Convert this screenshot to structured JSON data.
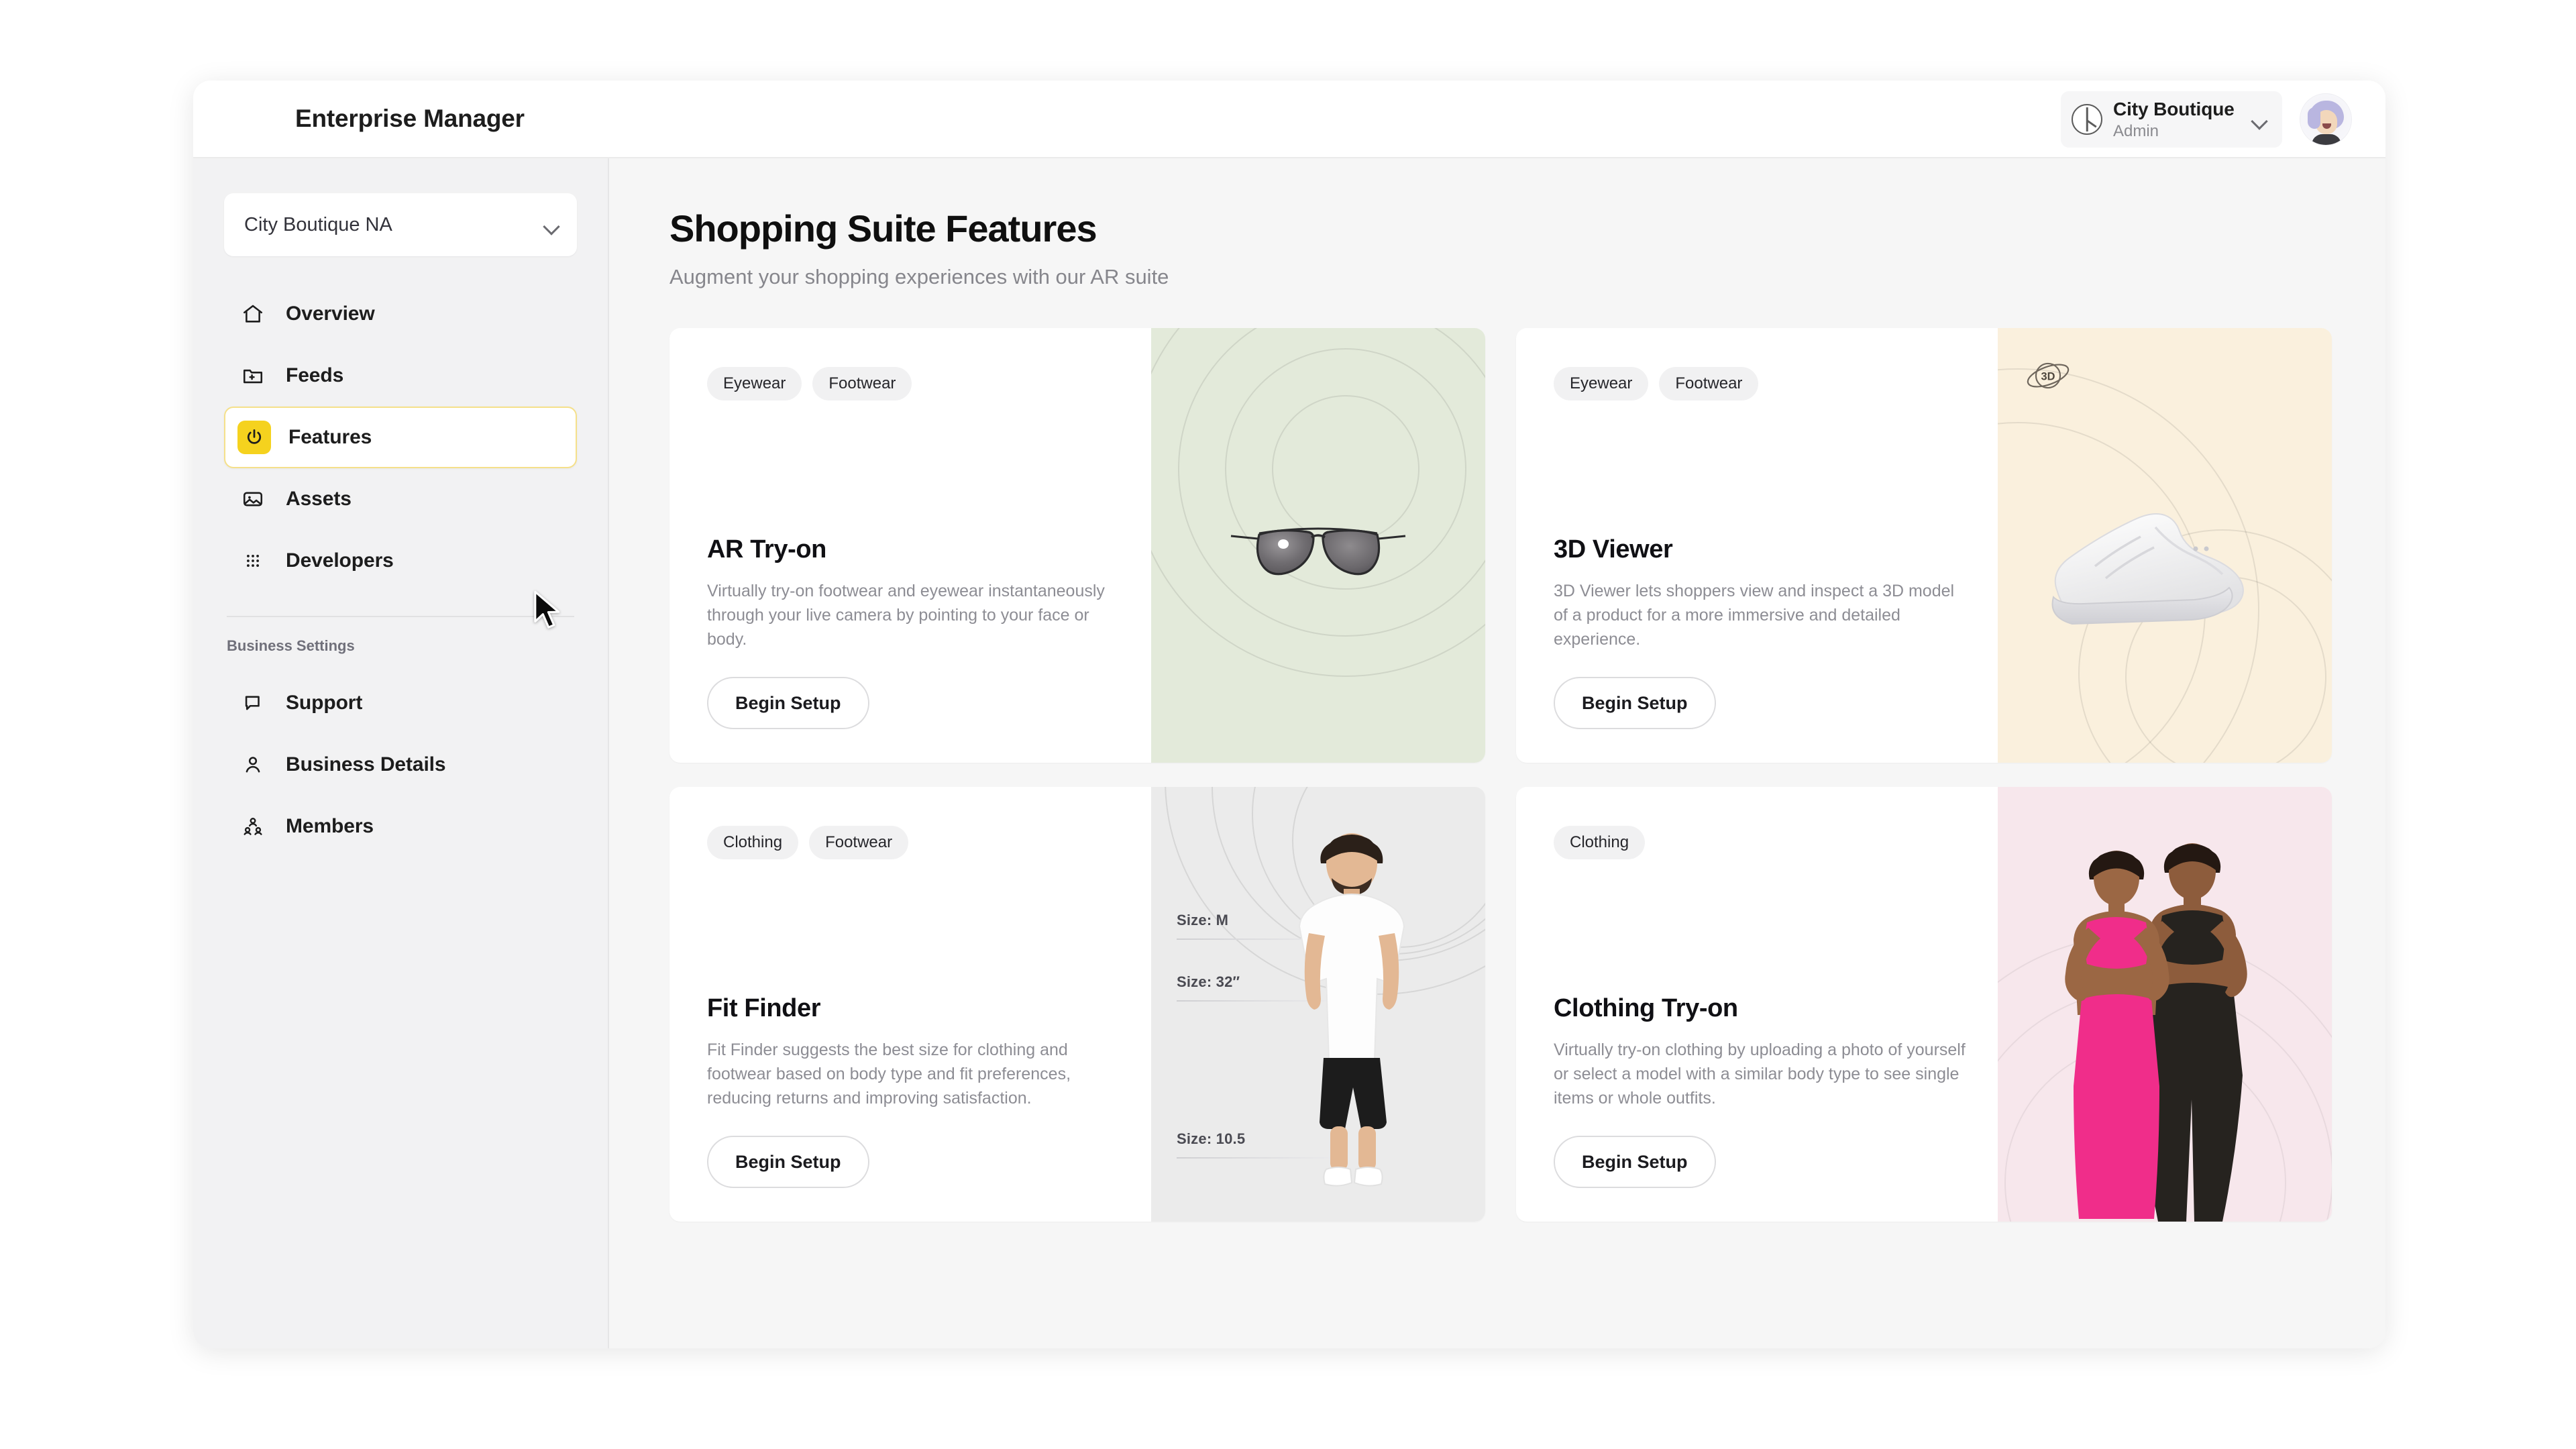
{
  "header": {
    "app_title": "Enterprise Manager",
    "org_name": "City Boutique",
    "org_role": "Admin",
    "org_logo_icon": "circle-chart-icon",
    "chevron_icon": "chevron-down-icon",
    "avatar_icon": "user-avatar"
  },
  "sidebar": {
    "store_select": {
      "value": "City Boutique NA",
      "chevron_icon": "chevron-down-icon"
    },
    "items": [
      {
        "label": "Overview",
        "icon": "home-icon",
        "active": false
      },
      {
        "label": "Feeds",
        "icon": "folder-add-icon",
        "active": false
      },
      {
        "label": "Features",
        "icon": "power-icon",
        "active": true
      },
      {
        "label": "Assets",
        "icon": "image-icon",
        "active": false
      },
      {
        "label": "Developers",
        "icon": "grid-dots-icon",
        "active": false
      }
    ],
    "section_title": "Business Settings",
    "settings_items": [
      {
        "label": "Support",
        "icon": "chat-bubble-icon"
      },
      {
        "label": "Business Details",
        "icon": "person-icon"
      },
      {
        "label": "Members",
        "icon": "people-group-icon"
      }
    ]
  },
  "main": {
    "title": "Shopping Suite Features",
    "subtitle": "Augment your shopping experiences with our AR suite",
    "cards": [
      {
        "chips": [
          "Eyewear",
          "Footwear"
        ],
        "title": "AR Try-on",
        "description": "Virtually try-on footwear and eyewear instantaneously through your live camera by pointing to your face or body.",
        "button": "Begin Setup",
        "media": {
          "variant": "media-green",
          "bg": "#e3eada",
          "art": "sunglasses"
        }
      },
      {
        "chips": [
          "Eyewear",
          "Footwear"
        ],
        "title": "3D Viewer",
        "description": "3D Viewer lets shoppers view and inspect a 3D model of a product for a more immersive and detailed experience.",
        "button": "Begin Setup",
        "media": {
          "variant": "media-cream",
          "bg": "#faf0dd",
          "art": "sneaker",
          "badge": "3D",
          "badge_icon": "orbit-3d-icon"
        }
      },
      {
        "chips": [
          "Clothing",
          "Footwear"
        ],
        "title": "Fit Finder",
        "description": "Fit Finder suggests the best size for clothing and footwear based on body type and fit preferences, reducing returns and improving satisfaction.",
        "button": "Begin Setup",
        "media": {
          "variant": "media-grey",
          "bg": "#ebebeb",
          "art": "person",
          "size_labels": [
            "Size: M",
            "Size: 32″",
            "Size: 10.5"
          ]
        }
      },
      {
        "chips": [
          "Clothing"
        ],
        "title": "Clothing Try-on",
        "description": "Virtually try-on clothing by uploading a photo of yourself or select a model with a similar body type to see single items or whole outfits.",
        "button": "Begin Setup",
        "media": {
          "variant": "media-pink",
          "bg": "#f7e7ec",
          "art": "models"
        }
      }
    ]
  },
  "colors": {
    "accent_yellow": "#f5d21e",
    "accent_yellow_border": "#f5e08a",
    "sidebar_bg": "#f2f2f3",
    "main_bg": "#f6f6f6",
    "card_bg": "#ffffff",
    "text_primary": "#101014",
    "text_muted": "#8d8d94"
  }
}
